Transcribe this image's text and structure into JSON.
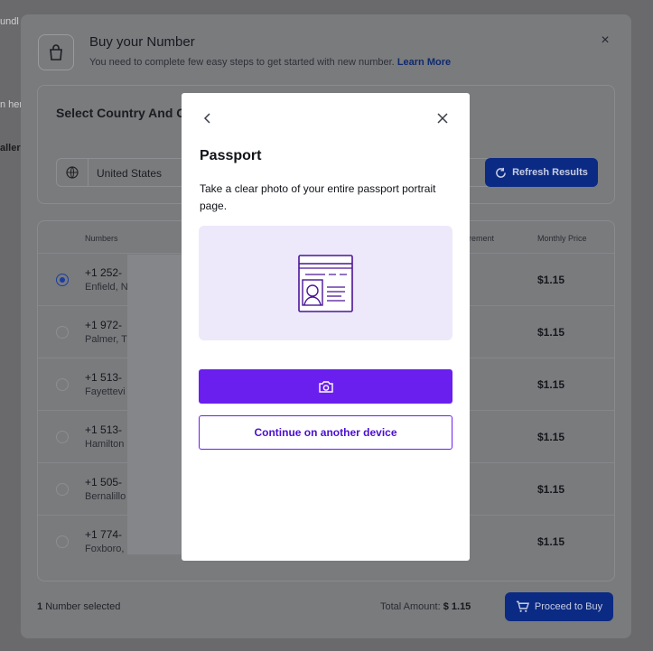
{
  "background": {
    "left_snippets": [
      "undl",
      "n her",
      "aller"
    ]
  },
  "modal": {
    "title": "Buy your Number",
    "subtitle": "You need to complete few easy steps to get started with new number.",
    "learn_more": "Learn More",
    "country_section_title": "Select Country And C",
    "country_value": "United States",
    "refresh_label": "Refresh Results",
    "table": {
      "headers": {
        "numbers": "Numbers",
        "requirement": "irement",
        "monthly_price": "Monthly Price"
      },
      "rows": [
        {
          "number": "+1 252-",
          "city": "Enfield, N",
          "price": "$1.15",
          "selected": true
        },
        {
          "number": "+1 972-",
          "city": "Palmer, T",
          "price": "$1.15",
          "selected": false
        },
        {
          "number": "+1 513-",
          "city": "Fayettevi",
          "price": "$1.15",
          "selected": false
        },
        {
          "number": "+1 513-",
          "city": "Hamilton",
          "price": "$1.15",
          "selected": false
        },
        {
          "number": "+1 505-",
          "city": "Bernalillo",
          "price": "$1.15",
          "selected": false
        },
        {
          "number": "+1 774-",
          "city": "Foxboro,",
          "price": "$1.15",
          "selected": false
        }
      ]
    },
    "footer": {
      "selected_count": "1",
      "selected_label": "Number selected",
      "total_label": "Total Amount:",
      "total_value": "$ 1.15",
      "proceed_label": "Proceed to Buy"
    }
  },
  "dialog": {
    "title": "Passport",
    "instructions": "Take a clear photo of your entire passport portrait page.",
    "camera_icon": "camera-icon",
    "alt_device_label": "Continue on another device",
    "accent_color": "#6a1fef",
    "illustration_bg": "#ede9fb"
  }
}
